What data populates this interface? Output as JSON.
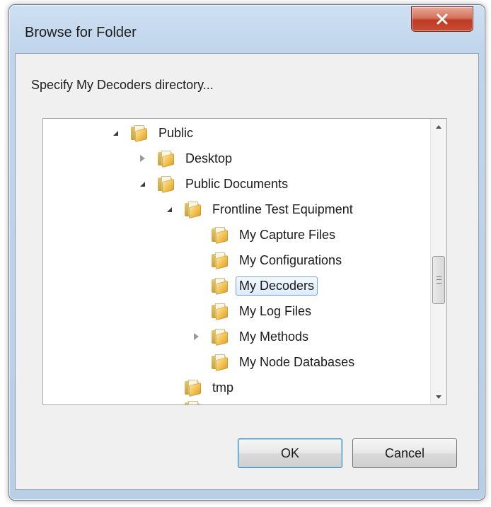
{
  "window": {
    "title": "Browse for Folder",
    "close_glyph": "✕"
  },
  "prompt": "Specify My Decoders directory...",
  "tree": {
    "items": [
      {
        "label": "Public",
        "icon": "folder-icon",
        "expander": "expanded"
      },
      {
        "label": "Desktop",
        "icon": "folder-icon",
        "expander": "collapsed"
      },
      {
        "label": "Public Documents",
        "icon": "folder-icon",
        "expander": "expanded"
      },
      {
        "label": "Frontline Test Equipment",
        "icon": "folder-icon",
        "expander": "expanded"
      },
      {
        "label": "My Capture Files",
        "icon": "folder-icon",
        "expander": "none"
      },
      {
        "label": "My Configurations",
        "icon": "folder-icon",
        "expander": "none"
      },
      {
        "label": "My Decoders",
        "icon": "folder-icon",
        "expander": "none",
        "selected": true
      },
      {
        "label": "My Log Files",
        "icon": "folder-icon",
        "expander": "none"
      },
      {
        "label": "My Methods",
        "icon": "folder-icon",
        "expander": "collapsed"
      },
      {
        "label": "My Node Databases",
        "icon": "folder-icon",
        "expander": "none"
      },
      {
        "label": "tmp",
        "icon": "folder-icon",
        "expander": "none"
      }
    ],
    "scrollbar_grip_glyph": "≡"
  },
  "buttons": {
    "ok": "OK",
    "cancel": "Cancel"
  },
  "colors": {
    "selection_border": "#7da2ce",
    "selection_fill": "#dcebfc",
    "close_button": "#c84d33",
    "folder": "#f2c04f"
  }
}
